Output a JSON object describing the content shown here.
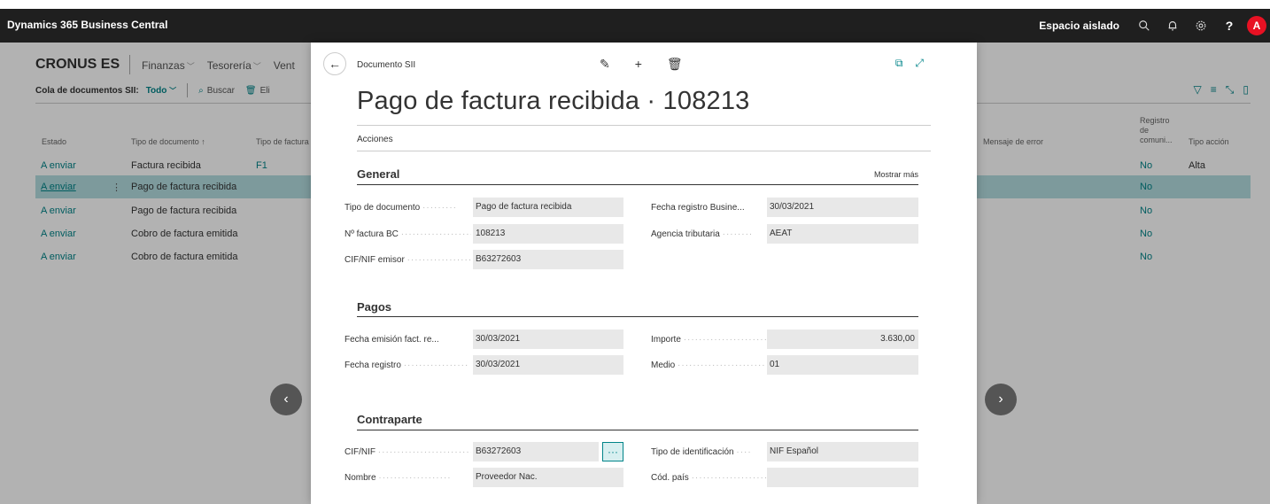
{
  "app": {
    "title": "Dynamics 365 Business Central",
    "environment": "Espacio aislado",
    "avatar_initial": "A",
    "help": "?"
  },
  "page": {
    "company": "CRONUS ES",
    "nav": [
      "Finanzas",
      "Tesorería",
      "Vent"
    ],
    "list_title": "Cola de documentos SII:",
    "filter": "Todo",
    "search_label": "Buscar",
    "delete_label": "Eli",
    "columns": {
      "estado": "Estado",
      "tipo_documento": "Tipo de documento ↑",
      "tipo_factura": "Tipo de factura",
      "mensaje_error": "Mensaje de error",
      "registro_line1": "Registro",
      "registro_line2": "de",
      "registro_line3": "comuni...",
      "tipo_accion": "Tipo acción"
    },
    "rows": [
      {
        "estado": "A enviar",
        "tipo": "Factura recibida",
        "tipo_factura": "F1",
        "registro": "No",
        "accion": "Alta"
      },
      {
        "estado": "A enviar",
        "tipo": "Pago de factura recibida",
        "tipo_factura": "",
        "registro": "No",
        "accion": ""
      },
      {
        "estado": "A enviar",
        "tipo": "Pago de factura recibida",
        "tipo_factura": "",
        "registro": "No",
        "accion": ""
      },
      {
        "estado": "A enviar",
        "tipo": "Cobro de factura emitida",
        "tipo_factura": "",
        "registro": "No",
        "accion": ""
      },
      {
        "estado": "A enviar",
        "tipo": "Cobro de factura emitida",
        "tipo_factura": "",
        "registro": "No",
        "accion": ""
      }
    ]
  },
  "dialog": {
    "caption": "Documento SII",
    "title": "Pago de factura recibida · 108213",
    "acciones": "Acciones",
    "general": {
      "title": "General",
      "show_more": "Mostrar más",
      "tipo_documento_label": "Tipo de documento",
      "tipo_documento": "Pago de factura recibida",
      "fecha_registro_label": "Fecha registro Busine...",
      "fecha_registro": "30/03/2021",
      "n_factura_label": "Nº factura BC",
      "n_factura": "108213",
      "agencia_label": "Agencia tributaria",
      "agencia": "AEAT",
      "cif_emisor_label": "CIF/NIF emisor",
      "cif_emisor": "B63272603"
    },
    "pagos": {
      "title": "Pagos",
      "fecha_emision_label": "Fecha emisión fact. re...",
      "fecha_emision": "30/03/2021",
      "importe_label": "Importe",
      "importe": "3.630,00",
      "fecha_registro_label": "Fecha registro",
      "fecha_registro": "30/03/2021",
      "medio_label": "Medio",
      "medio": "01"
    },
    "contraparte": {
      "title": "Contraparte",
      "cif_label": "CIF/NIF",
      "cif": "B63272603",
      "tipo_id_label": "Tipo de identificación",
      "tipo_id": "NIF Español",
      "nombre_label": "Nombre",
      "nombre": "Proveedor Nac.",
      "cod_pais_label": "Cód. país",
      "cod_pais": ""
    }
  },
  "colors": {
    "accent": "#008489",
    "header_bg": "#1f1f1f",
    "avatar": "#e81123",
    "selected_row": "#b3dde0"
  }
}
